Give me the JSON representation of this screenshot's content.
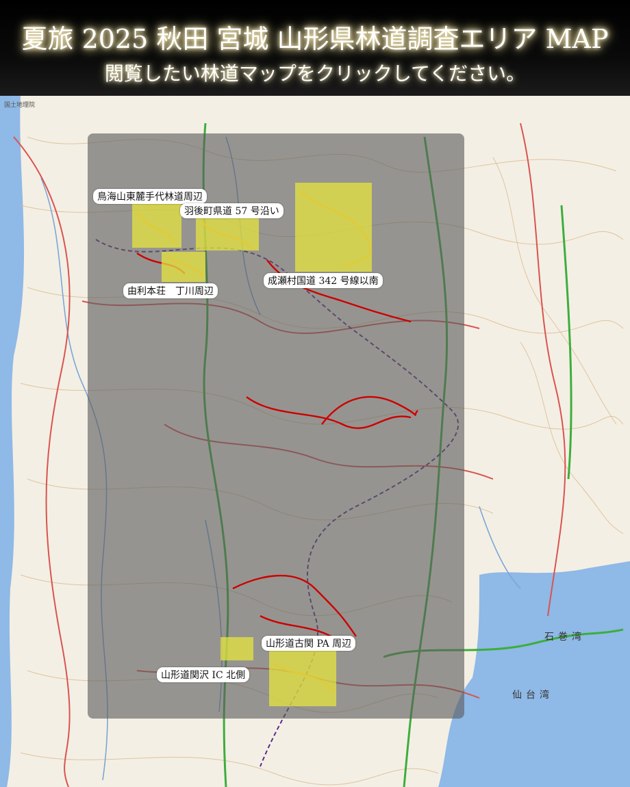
{
  "header": {
    "title": "夏旅 2025 秋田 宮城 山形県林道調査エリア MAP",
    "subtitle": "閲覧したい林道マップをクリックしてください。"
  },
  "map": {
    "attribution": "国土地理院",
    "sea_labels": [
      "石巻湾",
      "仙台湾"
    ],
    "areas": [
      {
        "label": "鳥海山東麓手代林道周辺"
      },
      {
        "label": "羽後町県道 57 号沿い"
      },
      {
        "label": "成瀬村国道 342 号線以南"
      },
      {
        "label": "由利本荘　丁川周辺"
      },
      {
        "label": "山形道古関 PA 周辺"
      },
      {
        "label": "山形道関沢 IC 北側"
      }
    ],
    "colors": {
      "highlight": "#e8e83c",
      "overlay": "#666666",
      "road": "#cc0000",
      "sea": "#8fb9e6"
    }
  }
}
